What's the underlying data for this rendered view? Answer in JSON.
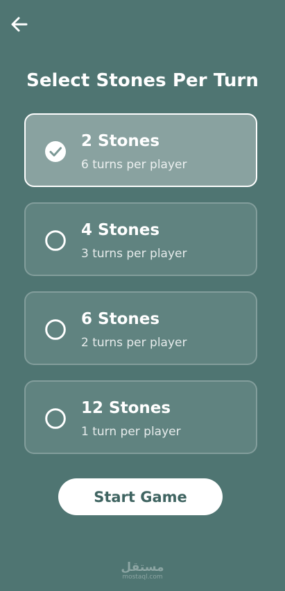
{
  "header": {
    "back_icon": "arrow-left-icon"
  },
  "page": {
    "title": "Select Stones Per Turn"
  },
  "options": [
    {
      "title": "2 Stones",
      "subtitle": "6 turns per player",
      "selected": true
    },
    {
      "title": "4 Stones",
      "subtitle": "3 turns per player",
      "selected": false
    },
    {
      "title": "6 Stones",
      "subtitle": "2 turns per player",
      "selected": false
    },
    {
      "title": "12 Stones",
      "subtitle": "1 turn per player",
      "selected": false
    }
  ],
  "actions": {
    "start_label": "Start Game"
  },
  "watermark": {
    "arabic": "مستقل",
    "latin": "mostaql.com"
  },
  "colors": {
    "background": "#4f7572",
    "button_text": "#3f6461",
    "text": "#ffffff"
  }
}
